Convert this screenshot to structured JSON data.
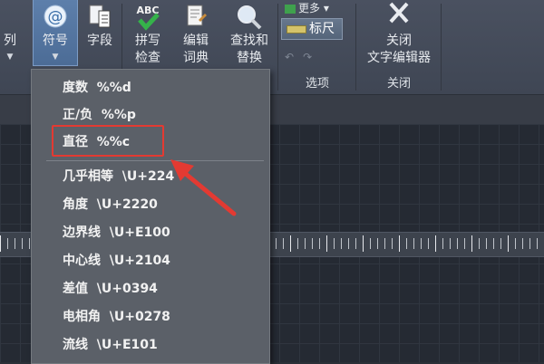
{
  "ribbon": {
    "buttons": {
      "partial": {
        "label": "列"
      },
      "symbol": {
        "label": "符号"
      },
      "field": {
        "label": "字段"
      },
      "spell": {
        "label": "拼写\n检查",
        "icon_text": "ABC"
      },
      "dict": {
        "label": "编辑\n词典"
      },
      "find": {
        "label": "查找和\n替换"
      },
      "close": {
        "label": "关闭\n文字编辑器"
      }
    },
    "options": {
      "more": "更多",
      "ruler": "标尺"
    },
    "group_labels": {
      "options": "选项",
      "close": "关闭"
    }
  },
  "symbol_menu": {
    "items": [
      {
        "name": "度数",
        "code": "%%d"
      },
      {
        "name": "正/负",
        "code": "%%p"
      },
      {
        "name": "直径",
        "code": "%%c"
      },
      {
        "name": "几乎相等",
        "code": "\\U+224"
      },
      {
        "name": "角度",
        "code": "\\U+2220"
      },
      {
        "name": "边界线",
        "code": "\\U+E100"
      },
      {
        "name": "中心线",
        "code": "\\U+2104"
      },
      {
        "name": "差值",
        "code": "\\U+0394"
      },
      {
        "name": "电相角",
        "code": "\\U+0278"
      },
      {
        "name": "流线",
        "code": "\\U+E101"
      }
    ],
    "highlighted_index": 2
  },
  "colors": {
    "highlight": "#e33a32",
    "arrow": "#e33a32",
    "menu_bg": "#5b6068",
    "ribbon_bg": "#454c5a"
  },
  "icons": {
    "symbol": "at-icon",
    "field": "field-icon",
    "spell": "spell-check-icon",
    "dict": "dictionary-icon",
    "find": "find-icon",
    "close": "close-icon"
  }
}
